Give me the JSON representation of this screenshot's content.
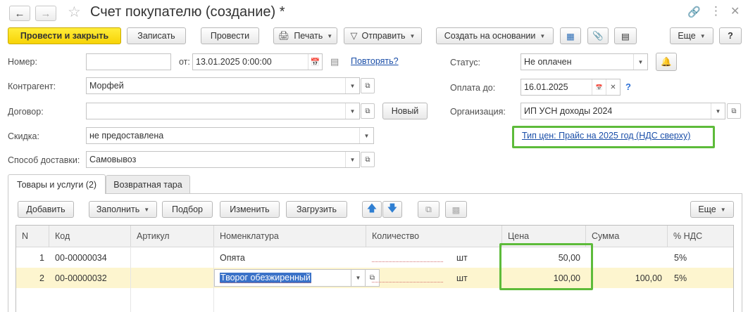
{
  "window": {
    "title": "Счет покупателю (создание) *",
    "back_icon": "arrow-left",
    "forward_icon": "arrow-right"
  },
  "toolbar": {
    "post_close": "Провести и закрыть",
    "save": "Записать",
    "post": "Провести",
    "print": "Печать",
    "send": "Отправить",
    "create_based": "Создать на основании",
    "more": "Еще"
  },
  "form": {
    "number_label": "Номер:",
    "number_value": "",
    "from_label": "от:",
    "date_value": "13.01.2025  0:00:00",
    "repeat_link": "Повторять?",
    "contractor_label": "Контрагент:",
    "contractor_value": "Морфей",
    "contract_label": "Договор:",
    "contract_value": "",
    "new_button": "Новый",
    "discount_label": "Скидка:",
    "discount_value": "не предоставлена",
    "delivery_label": "Способ доставки:",
    "delivery_value": "Самовывоз",
    "status_label": "Статус:",
    "status_value": "Не оплачен",
    "pay_until_label": "Оплата до:",
    "pay_until_value": "16.01.2025",
    "org_label": "Организация:",
    "org_value": "ИП УСН доходы 2024",
    "price_type_link": "Тип цен: Прайс на 2025 год (НДС сверху)",
    "help": "?"
  },
  "tabs": [
    {
      "label": "Товары и услуги (2)",
      "active": true
    },
    {
      "label": "Возвратная тара",
      "active": false
    }
  ],
  "table_toolbar": {
    "add": "Добавить",
    "fill": "Заполнить",
    "pick": "Подбор",
    "change": "Изменить",
    "load": "Загрузить",
    "more": "Еще"
  },
  "table": {
    "columns": [
      "N",
      "Код",
      "Артикул",
      "Номенклатура",
      "Количество",
      "Цена",
      "Сумма",
      "% НДС"
    ],
    "rows": [
      {
        "n": "1",
        "code": "00-00000034",
        "article": "",
        "item": "Опята",
        "qty": "",
        "unit": "шт",
        "price": "50,00",
        "sum": "",
        "vat": "5%",
        "selected": false
      },
      {
        "n": "2",
        "code": "00-00000032",
        "article": "",
        "item": "Творог обезжиренный",
        "qty": "",
        "unit": "шт",
        "price": "100,00",
        "sum": "100,00",
        "vat": "5%",
        "selected": true
      }
    ]
  },
  "colors": {
    "primary_button": "#f7d306",
    "highlight_box": "#5dbb3a",
    "selected_row": "#fdf5cf",
    "link": "#1a4ea8"
  }
}
